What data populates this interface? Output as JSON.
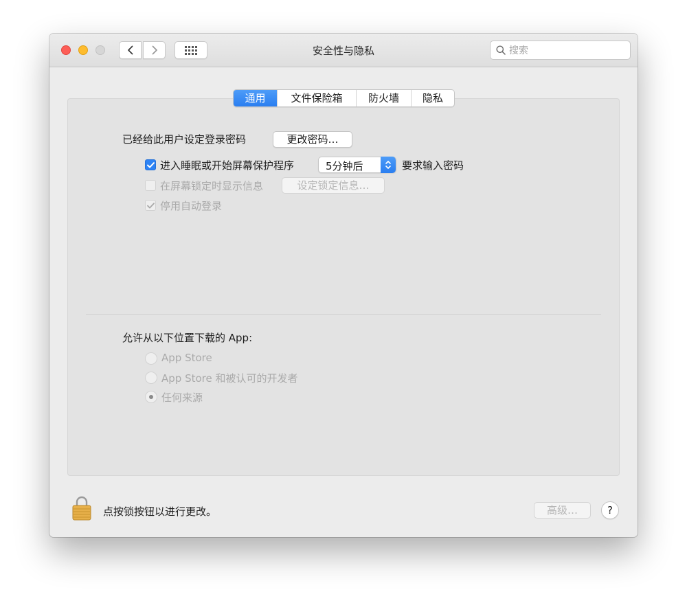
{
  "window": {
    "title": "安全性与隐私"
  },
  "search": {
    "placeholder": "搜索"
  },
  "tabs": [
    {
      "label": "通用",
      "active": true
    },
    {
      "label": "文件保险箱",
      "active": false
    },
    {
      "label": "防火墙",
      "active": false
    },
    {
      "label": "隐私",
      "active": false
    }
  ],
  "general": {
    "password_label": "已经给此用户设定登录密码",
    "change_password_button": "更改密码…",
    "require_password": {
      "checked": true,
      "label_before": "进入睡眠或开始屏幕保护程序",
      "delay_value": "5分钟后",
      "label_after": "要求输入密码"
    },
    "lock_message": {
      "checked": false,
      "label": "在屏幕锁定时显示信息",
      "button": "设定锁定信息…"
    },
    "disable_autologin": {
      "checked": true,
      "label": "停用自动登录"
    }
  },
  "downloads": {
    "heading": "允许从以下位置下载的 App:",
    "options": [
      {
        "label": "App Store",
        "selected": false
      },
      {
        "label": "App Store 和被认可的开发者",
        "selected": false
      },
      {
        "label": "任何来源",
        "selected": true
      }
    ]
  },
  "footer": {
    "lock_text": "点按锁按钮以进行更改。",
    "advanced_button": "高级…",
    "help_button": "?"
  },
  "colors": {
    "accent": "#2d83f5",
    "close": "#fd5e57",
    "minimize": "#febc2e"
  }
}
